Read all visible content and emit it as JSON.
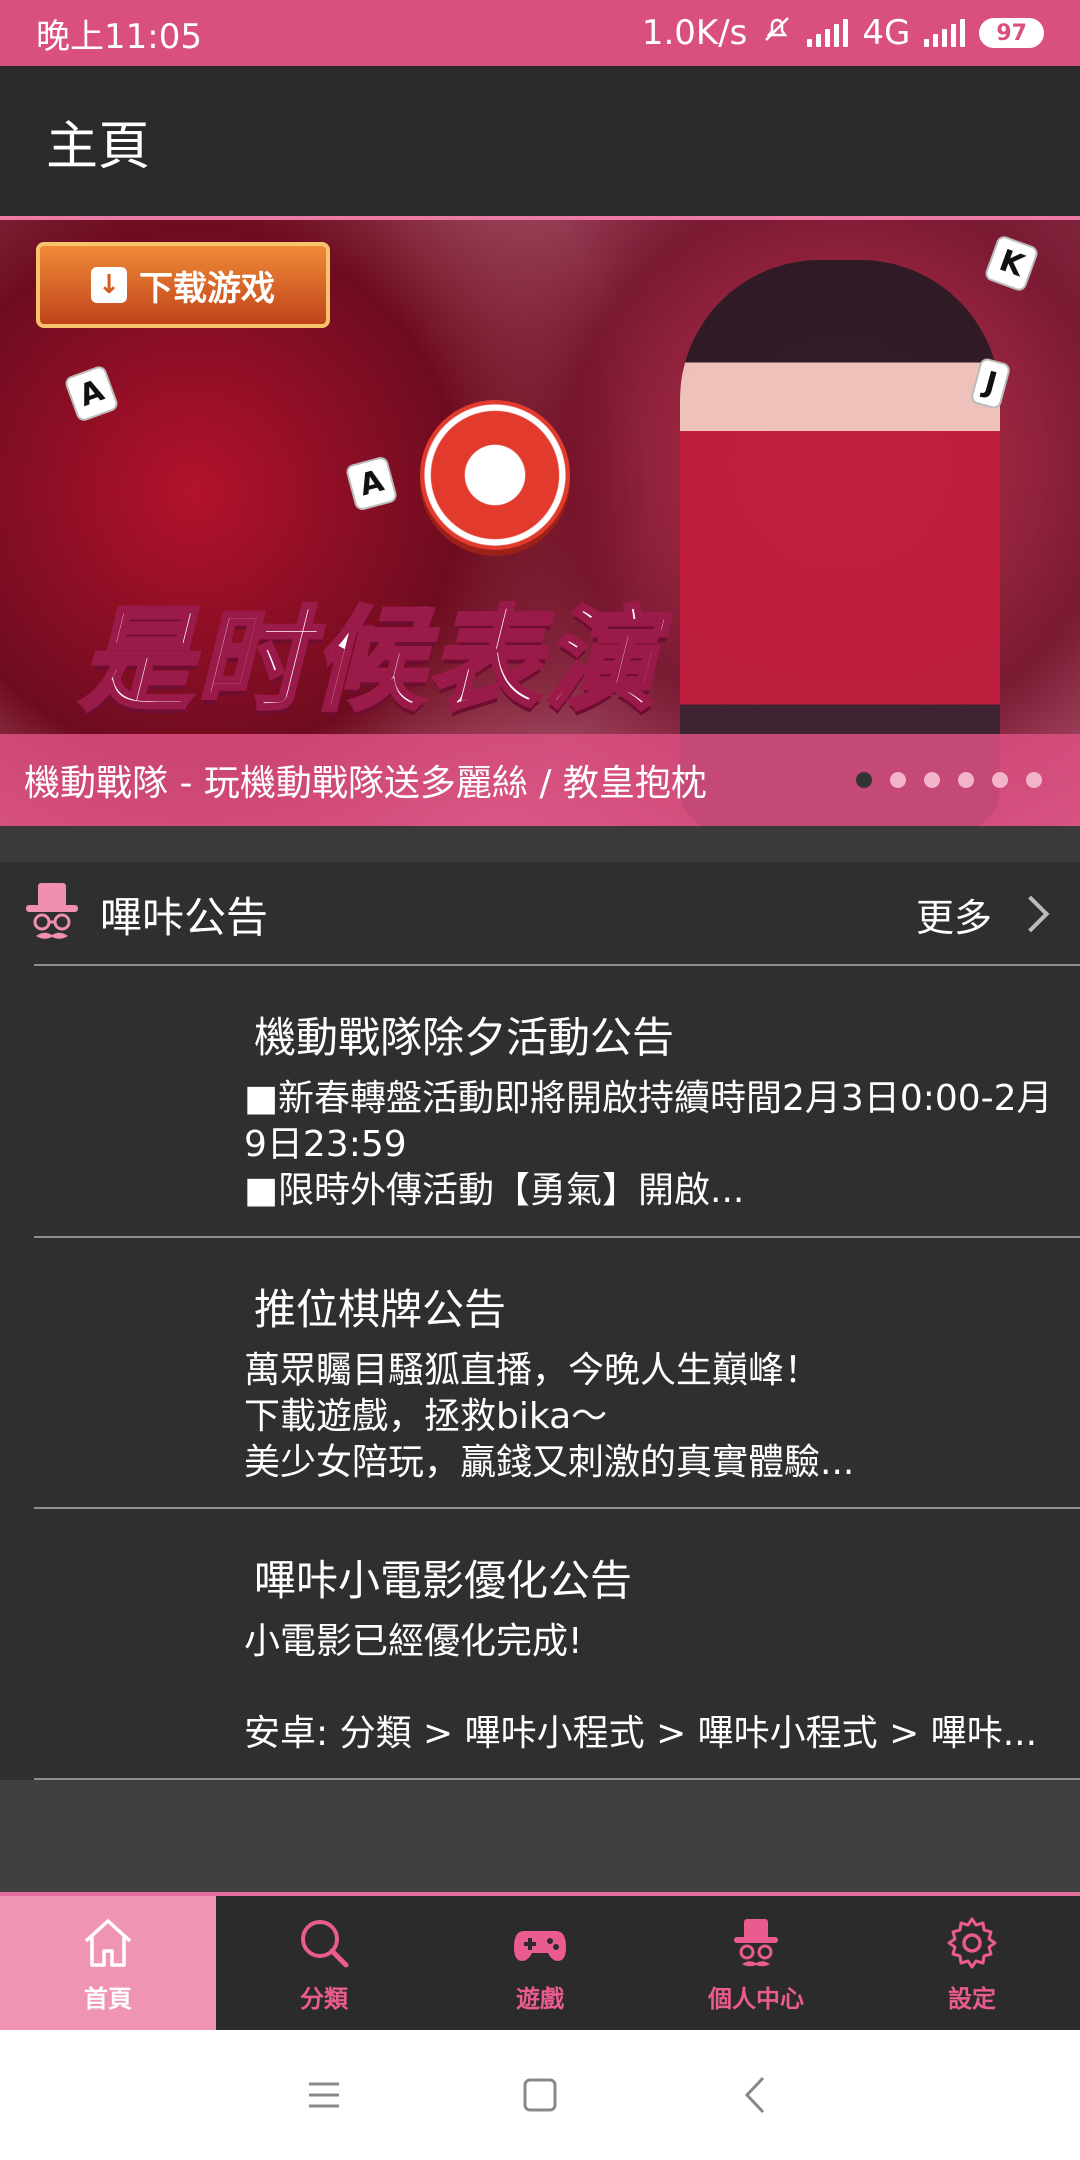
{
  "status_bar": {
    "time": "晚上11:05",
    "network_speed": "1.0K/s",
    "network_type": "4G",
    "battery": "97"
  },
  "app_bar": {
    "title": "主頁"
  },
  "banner": {
    "download_button": "下载游戏",
    "headline": "是时候表演",
    "caption": "機動戰隊 - 玩機動戰隊送多麗絲 / 教皇抱枕",
    "cards": [
      "A",
      "A",
      "K",
      "J"
    ],
    "page_count": 6,
    "active_page": 0
  },
  "announcements": {
    "header_title": "嗶咔公告",
    "more_label": "更多",
    "items": [
      {
        "title": "機動戰隊除夕活動公告",
        "body": "■新春轉盤活動即將開啟持續時間2月3日0:00-2月9日23:59\n■限時外傳活動【勇氣】開啟..."
      },
      {
        "title": "推位棋牌公告",
        "body": "萬眾矚目騷狐直播，今晚人生巔峰！\n下載遊戲，拯救bika～\n美少女陪玩，贏錢又刺激的真實體驗..."
      },
      {
        "title": "嗶咔小電影優化公告",
        "body": "小電影已經優化完成!\n\n安卓: 分類 > 嗶咔小程式 > 嗶咔小程式 > 嗶咔..."
      }
    ]
  },
  "bottom_nav": {
    "items": [
      {
        "label": "首頁",
        "icon": "home-icon",
        "active": true
      },
      {
        "label": "分類",
        "icon": "search-icon",
        "active": false
      },
      {
        "label": "遊戲",
        "icon": "gamepad-icon",
        "active": false
      },
      {
        "label": "個人中心",
        "icon": "profile-icon",
        "active": false
      },
      {
        "label": "設定",
        "icon": "gear-icon",
        "active": false
      }
    ]
  },
  "colors": {
    "accent": "#d9507e",
    "nav_active_bg": "#f094b5",
    "background": "#2f2f2f"
  }
}
